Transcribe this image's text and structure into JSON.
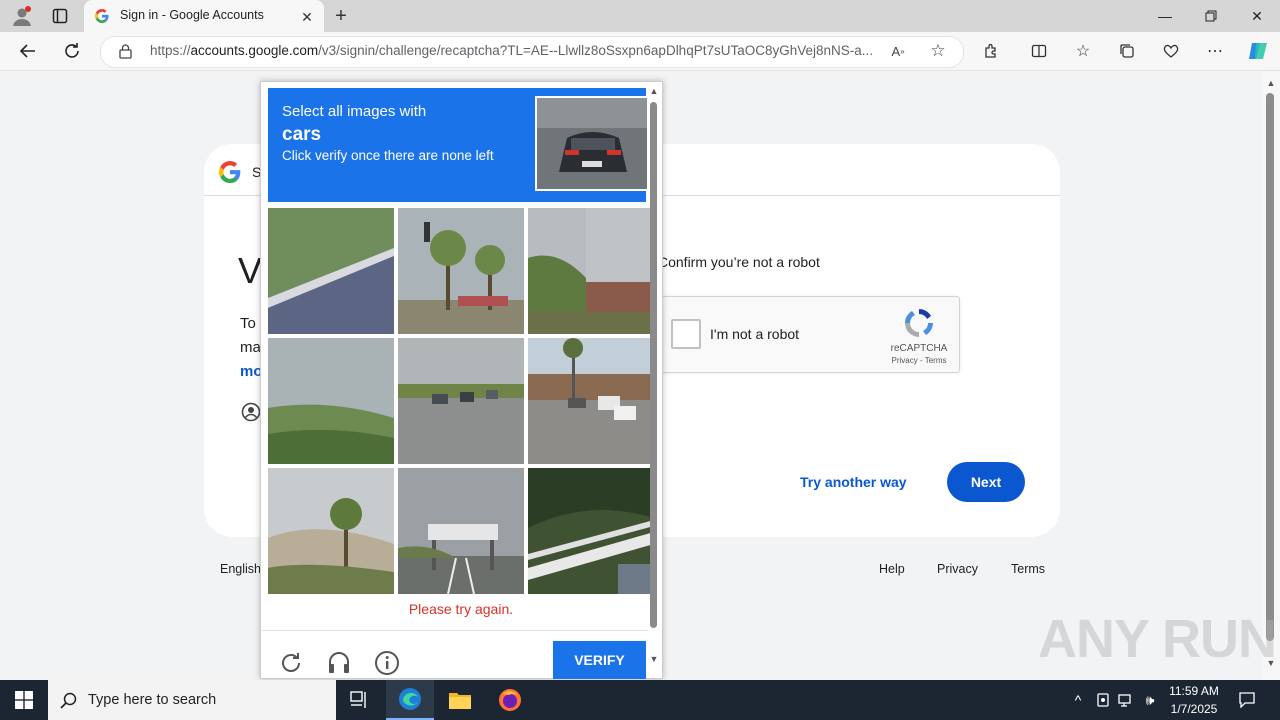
{
  "browser": {
    "tab_title": "Sign in - Google Accounts",
    "url_prefix": "https://",
    "url_domain": "accounts.google.com",
    "url_path": "/v3/signin/challenge/recaptcha?TL=AE--Llwllz8oSsxpn6apDlhqPt7sUTaOC8yGhVej8nNS-a..."
  },
  "signin_card": {
    "header_letter": "S",
    "heading_fragment": "V",
    "body_line1_fragment": "To",
    "body_line2_fragment": "ma",
    "link_fragment": "mo",
    "confirm_text": "Confirm you’re not a robot",
    "recaptcha_label": "I'm not a robot",
    "recaptcha_brand": "reCAPTCHA",
    "recaptcha_links": "Privacy - Terms",
    "try_another_way": "Try another way",
    "next_button": "Next"
  },
  "footer": {
    "language": "English",
    "help": "Help",
    "privacy": "Privacy",
    "terms": "Terms"
  },
  "captcha": {
    "instruction_line1": "Select all images with",
    "target": "cars",
    "instruction_line3": "Click verify once there are none left",
    "error": "Please try again.",
    "verify_button": "VERIFY",
    "tiles": [
      "road-guardrail",
      "palm-trees-traffic-light",
      "building-fence",
      "hillside-bushes",
      "highway-cars",
      "street-palms-cars",
      "hill-palm",
      "highway-sign",
      "fence-hedge"
    ]
  },
  "taskbar": {
    "search_placeholder": "Type here to search",
    "time": "11:59 AM",
    "date": "1/7/2025"
  },
  "watermark": "ANY RUN",
  "colors": {
    "google_blue": "#0b57d0",
    "captcha_blue": "#1a73e8",
    "error_red": "#d93025"
  }
}
